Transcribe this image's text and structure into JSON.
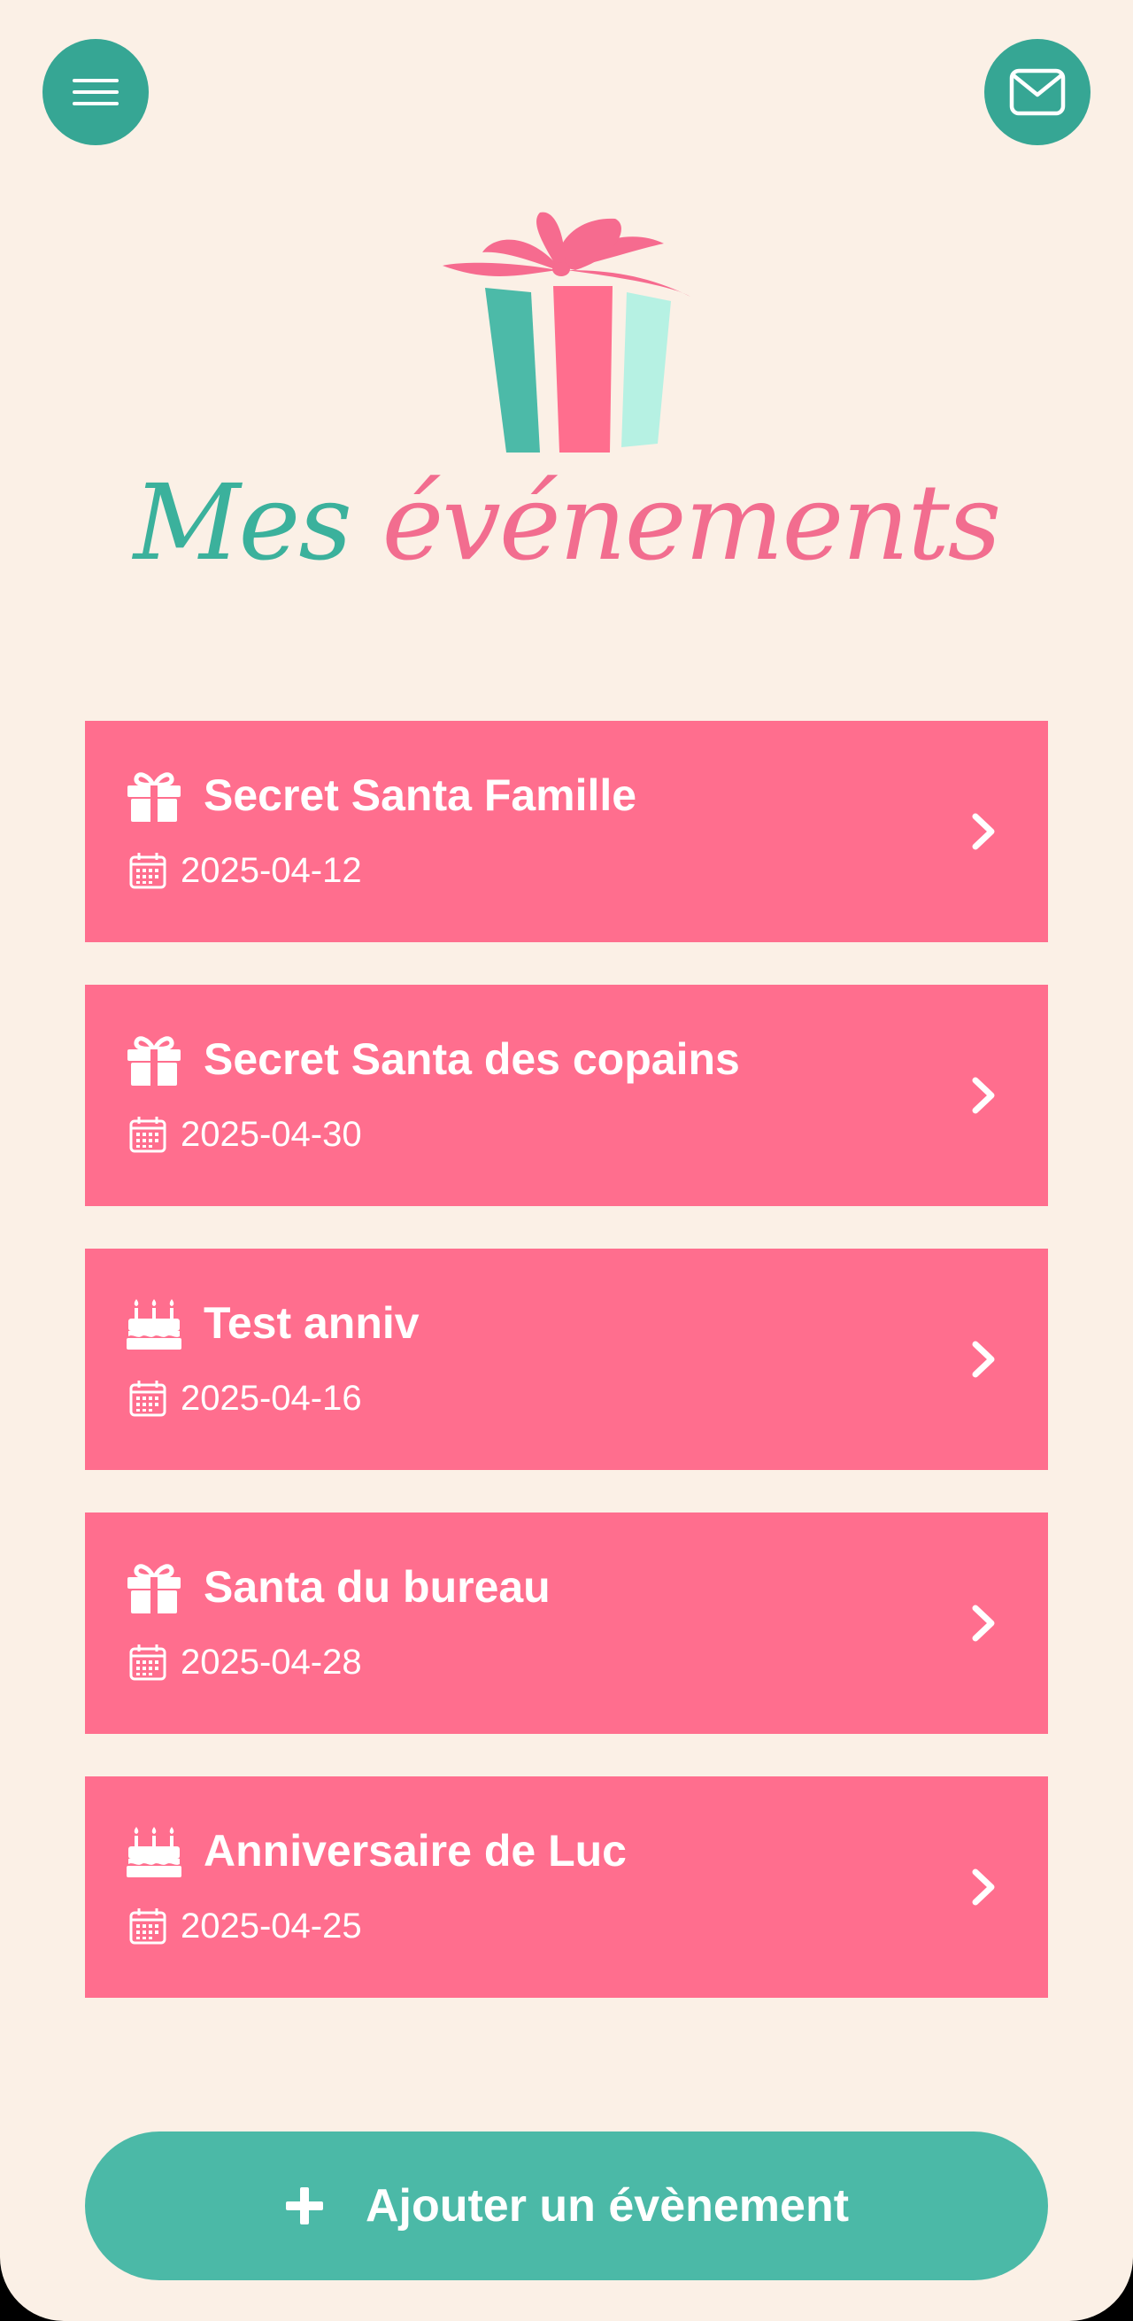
{
  "header": {
    "menu_icon": "hamburger-menu-icon",
    "mail_icon": "envelope-icon",
    "logo_icon": "gift-logo-icon",
    "title_part1": "Mes",
    "title_part2": "événements"
  },
  "events": [
    {
      "name": "Secret Santa Famille",
      "date": "2025-04-12",
      "icon": "gift-icon"
    },
    {
      "name": "Secret Santa des copains",
      "date": "2025-04-30",
      "icon": "gift-icon"
    },
    {
      "name": "Test anniv",
      "date": "2025-04-16",
      "icon": "birthday-cake-icon"
    },
    {
      "name": "Santa du bureau",
      "date": "2025-04-28",
      "icon": "gift-icon"
    },
    {
      "name": "Anniversaire de Luc",
      "date": "2025-04-25",
      "icon": "birthday-cake-icon"
    }
  ],
  "add_button": {
    "label": "Ajouter un évènement",
    "icon": "plus-icon"
  },
  "colors": {
    "background": "#fbf0e6",
    "teal": "#36a694",
    "card_pink": "#ff6e8e",
    "title_teal": "#3bb19c",
    "title_pink": "#f26d8f",
    "add_button": "#4bb9a7"
  }
}
